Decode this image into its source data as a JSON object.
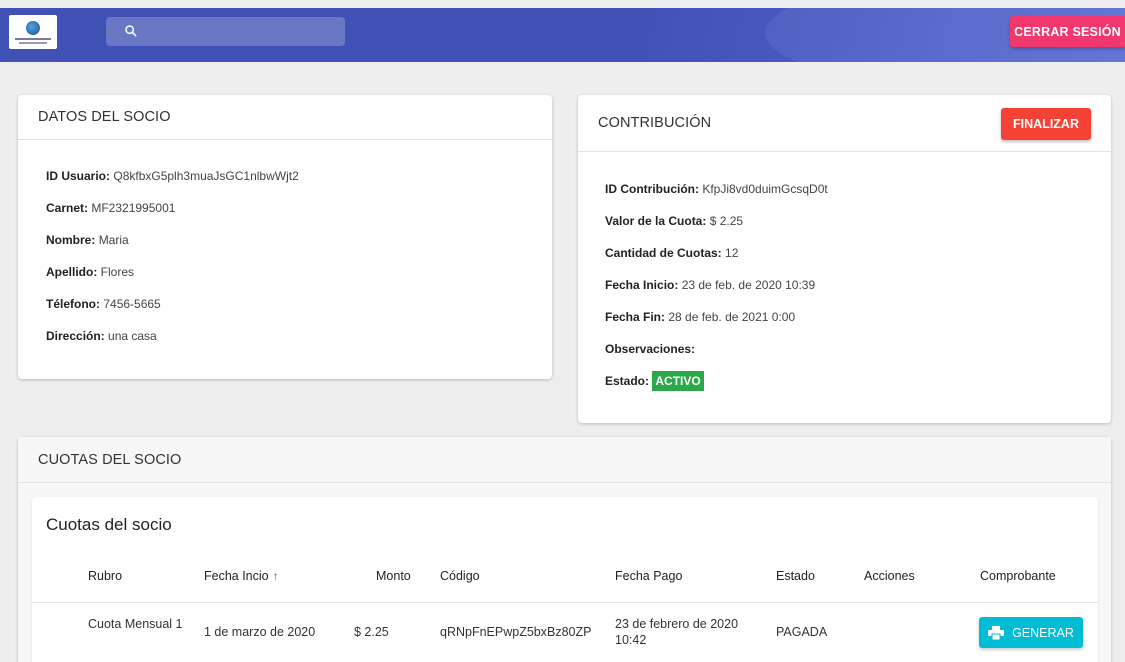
{
  "header": {
    "search_placeholder": "",
    "logout_label": "CERRAR SESIÓN",
    "colors": {
      "bar": "#3f51b5",
      "logout": "#f2376e"
    }
  },
  "socio": {
    "title": "DATOS DEL SOCIO",
    "fields": [
      {
        "label": "ID Usuario:",
        "value": "Q8kfbxG5plh3muaJsGC1nlbwWjt2"
      },
      {
        "label": "Carnet:",
        "value": "MF2321995001"
      },
      {
        "label": "Nombre:",
        "value": "Maria"
      },
      {
        "label": "Apellido:",
        "value": "Flores"
      },
      {
        "label": "Télefono:",
        "value": "7456-5665"
      },
      {
        "label": "Dirección:",
        "value": "una casa"
      }
    ]
  },
  "contribucion": {
    "title": "CONTRIBUCIÓN",
    "finalizar_label": "FINALIZAR",
    "fields": [
      {
        "label": "ID Contribución:",
        "value": "KfpJi8vd0duimGcsqD0t"
      },
      {
        "label": "Valor de la Cuota:",
        "value": "$ 2.25"
      },
      {
        "label": "Cantidad de Cuotas:",
        "value": "12"
      },
      {
        "label": "Fecha Inicio:",
        "value": "23 de feb. de 2020 10:39"
      },
      {
        "label": "Fecha Fin:",
        "value": "28 de feb. de 2021 0:00"
      },
      {
        "label": "Observaciones:",
        "value": ""
      }
    ],
    "estado_label": "Estado:",
    "estado_value": "ACTIVO",
    "colors": {
      "finalizar": "#f44336",
      "activo": "#2ba84a"
    }
  },
  "cuotas": {
    "section_title": "CUOTAS DEL SOCIO",
    "table_title": "Cuotas del socio",
    "columns": [
      "Rubro",
      "Fecha Incio",
      "Monto",
      "Código",
      "Fecha Pago",
      "Estado",
      "Acciones",
      "Comprobante"
    ],
    "sort_icon": "arrow-up-icon",
    "rows": [
      {
        "rubro": "Cuota Mensual 1",
        "fecha_inicio": "1 de marzo de 2020",
        "monto": "$ 2.25",
        "codigo": "qRNpFnEPwpZ5bxBz80ZP",
        "fecha_pago": "23 de febrero de 2020 10:42",
        "estado": "PAGADA",
        "acciones": "",
        "comprobante_label": "GENERAR"
      }
    ],
    "colors": {
      "generar": "#00bcd4"
    }
  }
}
